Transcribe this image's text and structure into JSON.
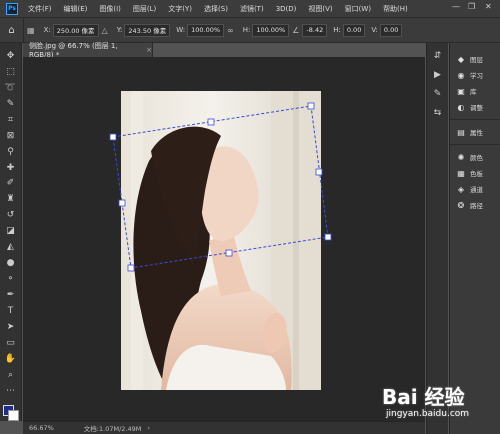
{
  "menubar": {
    "logo": "Ps",
    "items": [
      "文件(F)",
      "编辑(E)",
      "图像(I)",
      "图层(L)",
      "文字(Y)",
      "选择(S)",
      "滤镜(T)",
      "3D(D)",
      "视图(V)",
      "窗口(W)",
      "帮助(H)"
    ],
    "window_controls": [
      "—",
      "❐",
      "✕"
    ]
  },
  "options": {
    "x_label": "X:",
    "x_value": "250.00 像素",
    "y_label": "Y:",
    "y_value": "243.50 像素",
    "w_label": "W:",
    "w_value": "100.00%",
    "h_label": "H:",
    "h_value": "100.00%",
    "angle_value": "-8.42",
    "h_skew_label": "H:",
    "h_skew_value": "0.00",
    "v_skew_label": "V:",
    "v_skew_value": "0.00"
  },
  "document": {
    "tab_title": "侧脸.jpg @ 66.7% (图层 1, RGB/8) *",
    "tab_close": "×"
  },
  "statusbar": {
    "zoom": "66.67%",
    "doc_info": "文档:1.07M/2.49M",
    "arrow": "›"
  },
  "panels": {
    "items": [
      {
        "icon": "◆",
        "label": "图层"
      },
      {
        "icon": "◉",
        "label": "学习"
      },
      {
        "icon": "▣",
        "label": "库"
      },
      {
        "icon": "◐",
        "label": "调整"
      },
      {
        "icon": "▤",
        "label": "属性"
      },
      {
        "icon": "✺",
        "label": "颜色"
      },
      {
        "icon": "▦",
        "label": "色板"
      },
      {
        "icon": "◈",
        "label": "通道"
      },
      {
        "icon": "❂",
        "label": "路径"
      }
    ]
  },
  "colors": {
    "foreground": "#1f2d8a",
    "background": "#ffffff",
    "transform_box": "#3a4bd8"
  },
  "watermark": {
    "brand": "Bai 经验",
    "url": "jingyan.baidu.com"
  }
}
